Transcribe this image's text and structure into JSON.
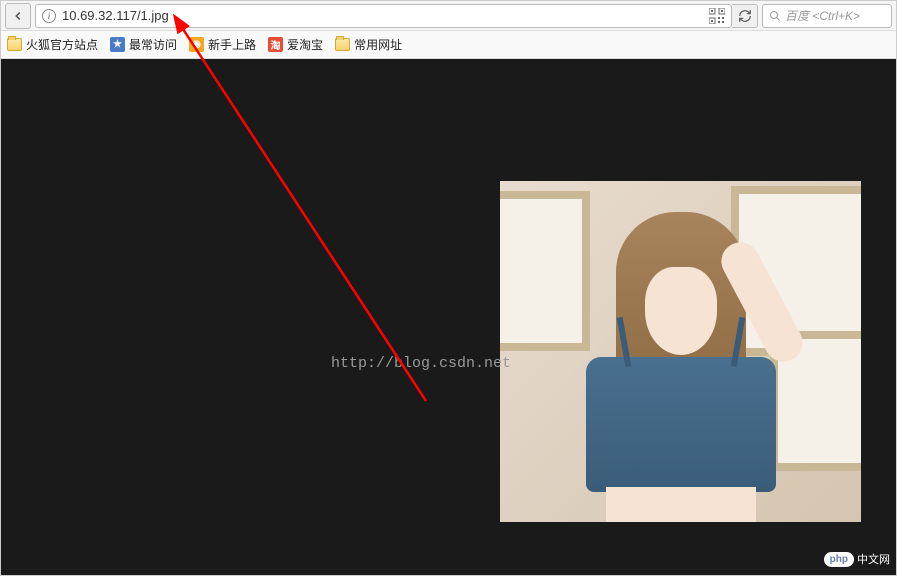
{
  "urlbar": {
    "address": "10.69.32.117/1.jpg"
  },
  "search": {
    "placeholder": "百度 <Ctrl+K>"
  },
  "bookmarks": [
    {
      "label": "火狐官方站点",
      "icon": "folder"
    },
    {
      "label": "最常访问",
      "icon": "fav-blue"
    },
    {
      "label": "新手上路",
      "icon": "fav-orange"
    },
    {
      "label": "爱淘宝",
      "icon": "fav-red",
      "badge": "淘"
    },
    {
      "label": "常用网址",
      "icon": "folder"
    }
  ],
  "watermark": {
    "blog": "http://blog.csdn.net",
    "corner_badge": "php",
    "corner_text": "中文网"
  }
}
